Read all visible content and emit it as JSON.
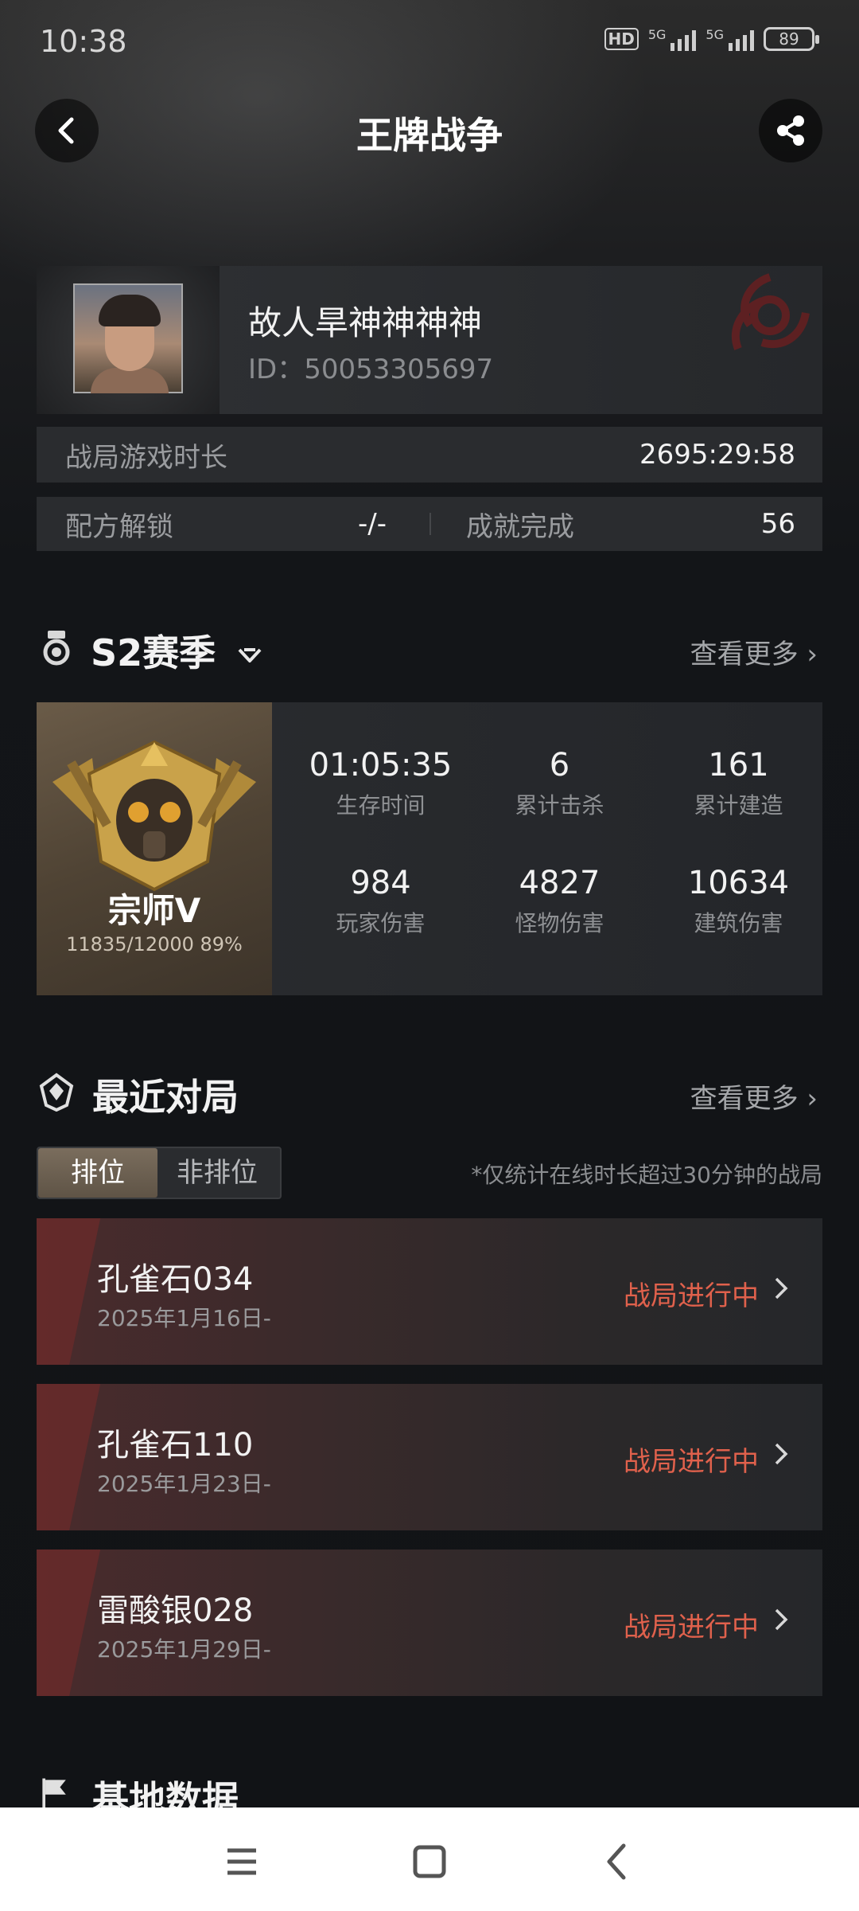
{
  "status_bar": {
    "time": "10:38",
    "network_1": "5G",
    "network_2": "5G",
    "hd": "HD",
    "battery": "89"
  },
  "header": {
    "title": "王牌战争"
  },
  "profile": {
    "name": "故人旱神神神神",
    "id_text": "ID：50053305697"
  },
  "play_time": {
    "label": "战局游戏时长",
    "value": "2695:29:58"
  },
  "unlock": {
    "label": "配方解锁",
    "value": "-/-",
    "ach_label": "成就完成",
    "ach_value": "56"
  },
  "season": {
    "title": "S2赛季",
    "more": "查看更多",
    "rank": "宗师V",
    "progress": "11835/12000 89%",
    "stats": [
      {
        "value": "01:05:35",
        "label": "生存时间"
      },
      {
        "value": "6",
        "label": "累计击杀"
      },
      {
        "value": "161",
        "label": "累计建造"
      },
      {
        "value": "984",
        "label": "玩家伤害"
      },
      {
        "value": "4827",
        "label": "怪物伤害"
      },
      {
        "value": "10634",
        "label": "建筑伤害"
      }
    ]
  },
  "recent": {
    "title": "最近对局",
    "more": "查看更多",
    "tabs": [
      {
        "label": "排位",
        "active": true
      },
      {
        "label": "非排位",
        "active": false
      }
    ],
    "note": "*仅统计在线时长超过30分钟的战局",
    "matches": [
      {
        "name": "孔雀石034",
        "date": "2025年1月16日-",
        "status": "战局进行中"
      },
      {
        "name": "孔雀石110",
        "date": "2025年1月23日-",
        "status": "战局进行中"
      },
      {
        "name": "雷酸银028",
        "date": "2025年1月29日-",
        "status": "战局进行中"
      }
    ]
  },
  "base": {
    "title": "基地数据"
  },
  "colors": {
    "accent_status": "#e0614c",
    "background": "#101215"
  }
}
